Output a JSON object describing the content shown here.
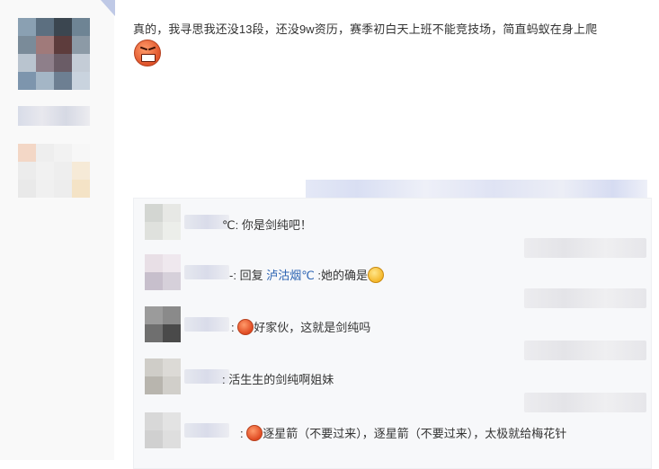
{
  "post": {
    "text": "真的，我寻思我还没13段，还没9w资历，赛季初白天上班不能竞技场，简直蚂蚁在身上爬",
    "emoji": "angry-face-icon"
  },
  "replies": [
    {
      "prefix": "℃: ",
      "text": "你是剑纯吧！"
    },
    {
      "prefix": "-: ",
      "reply_label": "回复 ",
      "reply_to": "泸沽烟℃",
      "suffix": " :她的确是",
      "emoji": "yellow-face-icon"
    },
    {
      "prefix": ": ",
      "emoji": "red-face-icon",
      "text": "好家伙，这就是剑纯吗"
    },
    {
      "prefix": ": ",
      "text": "活生生的剑纯啊姐妹"
    },
    {
      "prefix": ": ",
      "emoji": "red-face-icon",
      "text": "逐星箭（不要过来），逐星箭（不要过来），太极就给梅花针"
    }
  ],
  "colors": {
    "link": "#2d64b3",
    "panel_bg": "#f7f8fa"
  }
}
